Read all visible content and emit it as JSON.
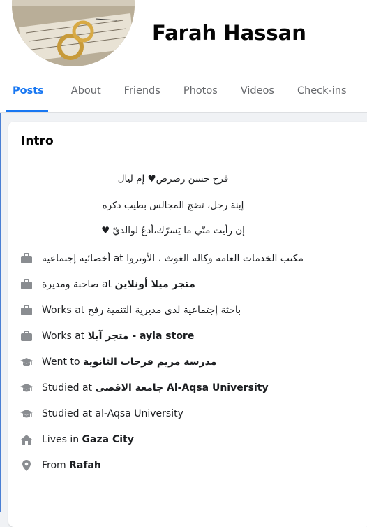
{
  "profile": {
    "name": "Farah Hassan"
  },
  "tabs": [
    {
      "label": "Posts",
      "active": true
    },
    {
      "label": "About"
    },
    {
      "label": "Friends"
    },
    {
      "label": "Photos"
    },
    {
      "label": "Videos"
    },
    {
      "label": "Check-ins"
    }
  ],
  "intro": {
    "title": "Intro",
    "bio": [
      "فرح حسن رصرص♥ إم ليال",
      "إبنة رجل، تضج المجالس بطيب ذكره",
      "إن رأيت منّي ما يَسرّك،أدعُ لوالديّ ♥"
    ],
    "details": [
      {
        "icon": "briefcase-icon",
        "text": "مكتب الخدمات العامة وكالة الغوث ، الأونروا at أخصائية إجتماعية"
      },
      {
        "icon": "briefcase-icon",
        "prefix": "",
        "bold": "متجر ميلا أونلاين",
        "suffix": " at صاحبة ومديرة"
      },
      {
        "icon": "briefcase-icon",
        "text": "باحثة إجتماعية لدى مديرية التنمية رفح Works at"
      },
      {
        "icon": "briefcase-icon",
        "prefix": "Works at ",
        "bold": "متجر آيلا - ayla store",
        "suffix": ""
      },
      {
        "icon": "graduation-cap-icon",
        "prefix": "",
        "bold": "مدرسة مريم فرحات الثانوية",
        "suffix": " Went to"
      },
      {
        "icon": "graduation-cap-icon",
        "prefix": "Studied at ",
        "bold": "جامعة الاقصى Al-Aqsa University",
        "suffix": ""
      },
      {
        "icon": "graduation-cap-icon",
        "text": "Studied at al-Aqsa University"
      },
      {
        "icon": "home-icon",
        "prefix": "Lives in ",
        "bold": "Gaza City",
        "suffix": ""
      },
      {
        "icon": "location-pin-icon",
        "prefix": "From ",
        "bold": "Rafah",
        "suffix": ""
      }
    ]
  },
  "colors": {
    "accent": "#1877f2",
    "icon": "#8a8d91",
    "background": "#f0f2f5"
  }
}
